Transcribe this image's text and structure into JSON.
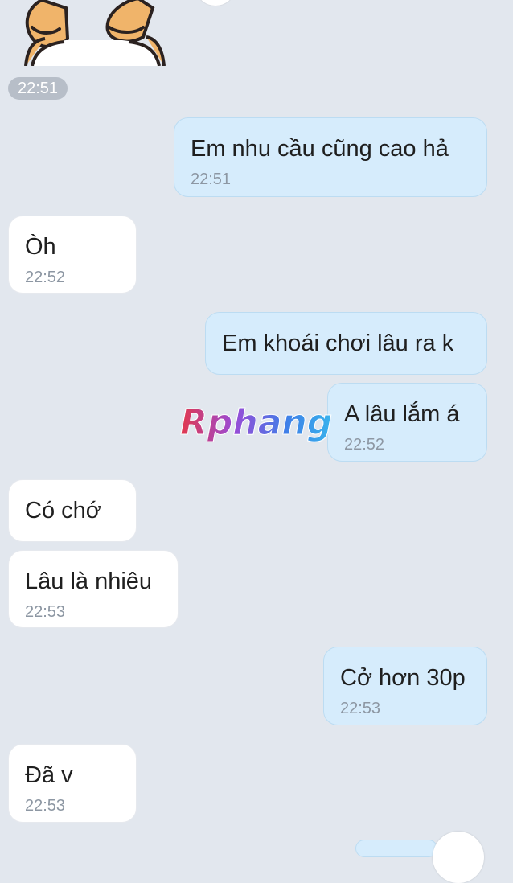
{
  "sticker": {
    "icon": "thumbs-up-cat-sticker-icon"
  },
  "date_pill": {
    "time": "22:51"
  },
  "messages": [
    {
      "dir": "out",
      "text": "Em nhu cầu cũng cao hả",
      "time": "22:51"
    },
    {
      "dir": "in",
      "text": "Òh",
      "time": "22:52"
    },
    {
      "dir": "out",
      "text": "Em khoái chơi lâu ra k",
      "time": ""
    },
    {
      "dir": "out",
      "text": "A lâu lắm á",
      "time": "22:52"
    },
    {
      "dir": "in",
      "text": "Có chớ",
      "time": ""
    },
    {
      "dir": "in",
      "text": "Lâu là nhiêu",
      "time": "22:53"
    },
    {
      "dir": "out",
      "text": "Cở hơn 30p",
      "time": "22:53"
    },
    {
      "dir": "in",
      "text": "Đã v",
      "time": "22:53"
    }
  ],
  "watermark": {
    "text": "Rphang"
  },
  "colors": {
    "background": "#e2e7ee",
    "outgoing_bubble": "#d6ecfc",
    "incoming_bubble": "#ffffff",
    "time_text": "#8d97a3"
  }
}
